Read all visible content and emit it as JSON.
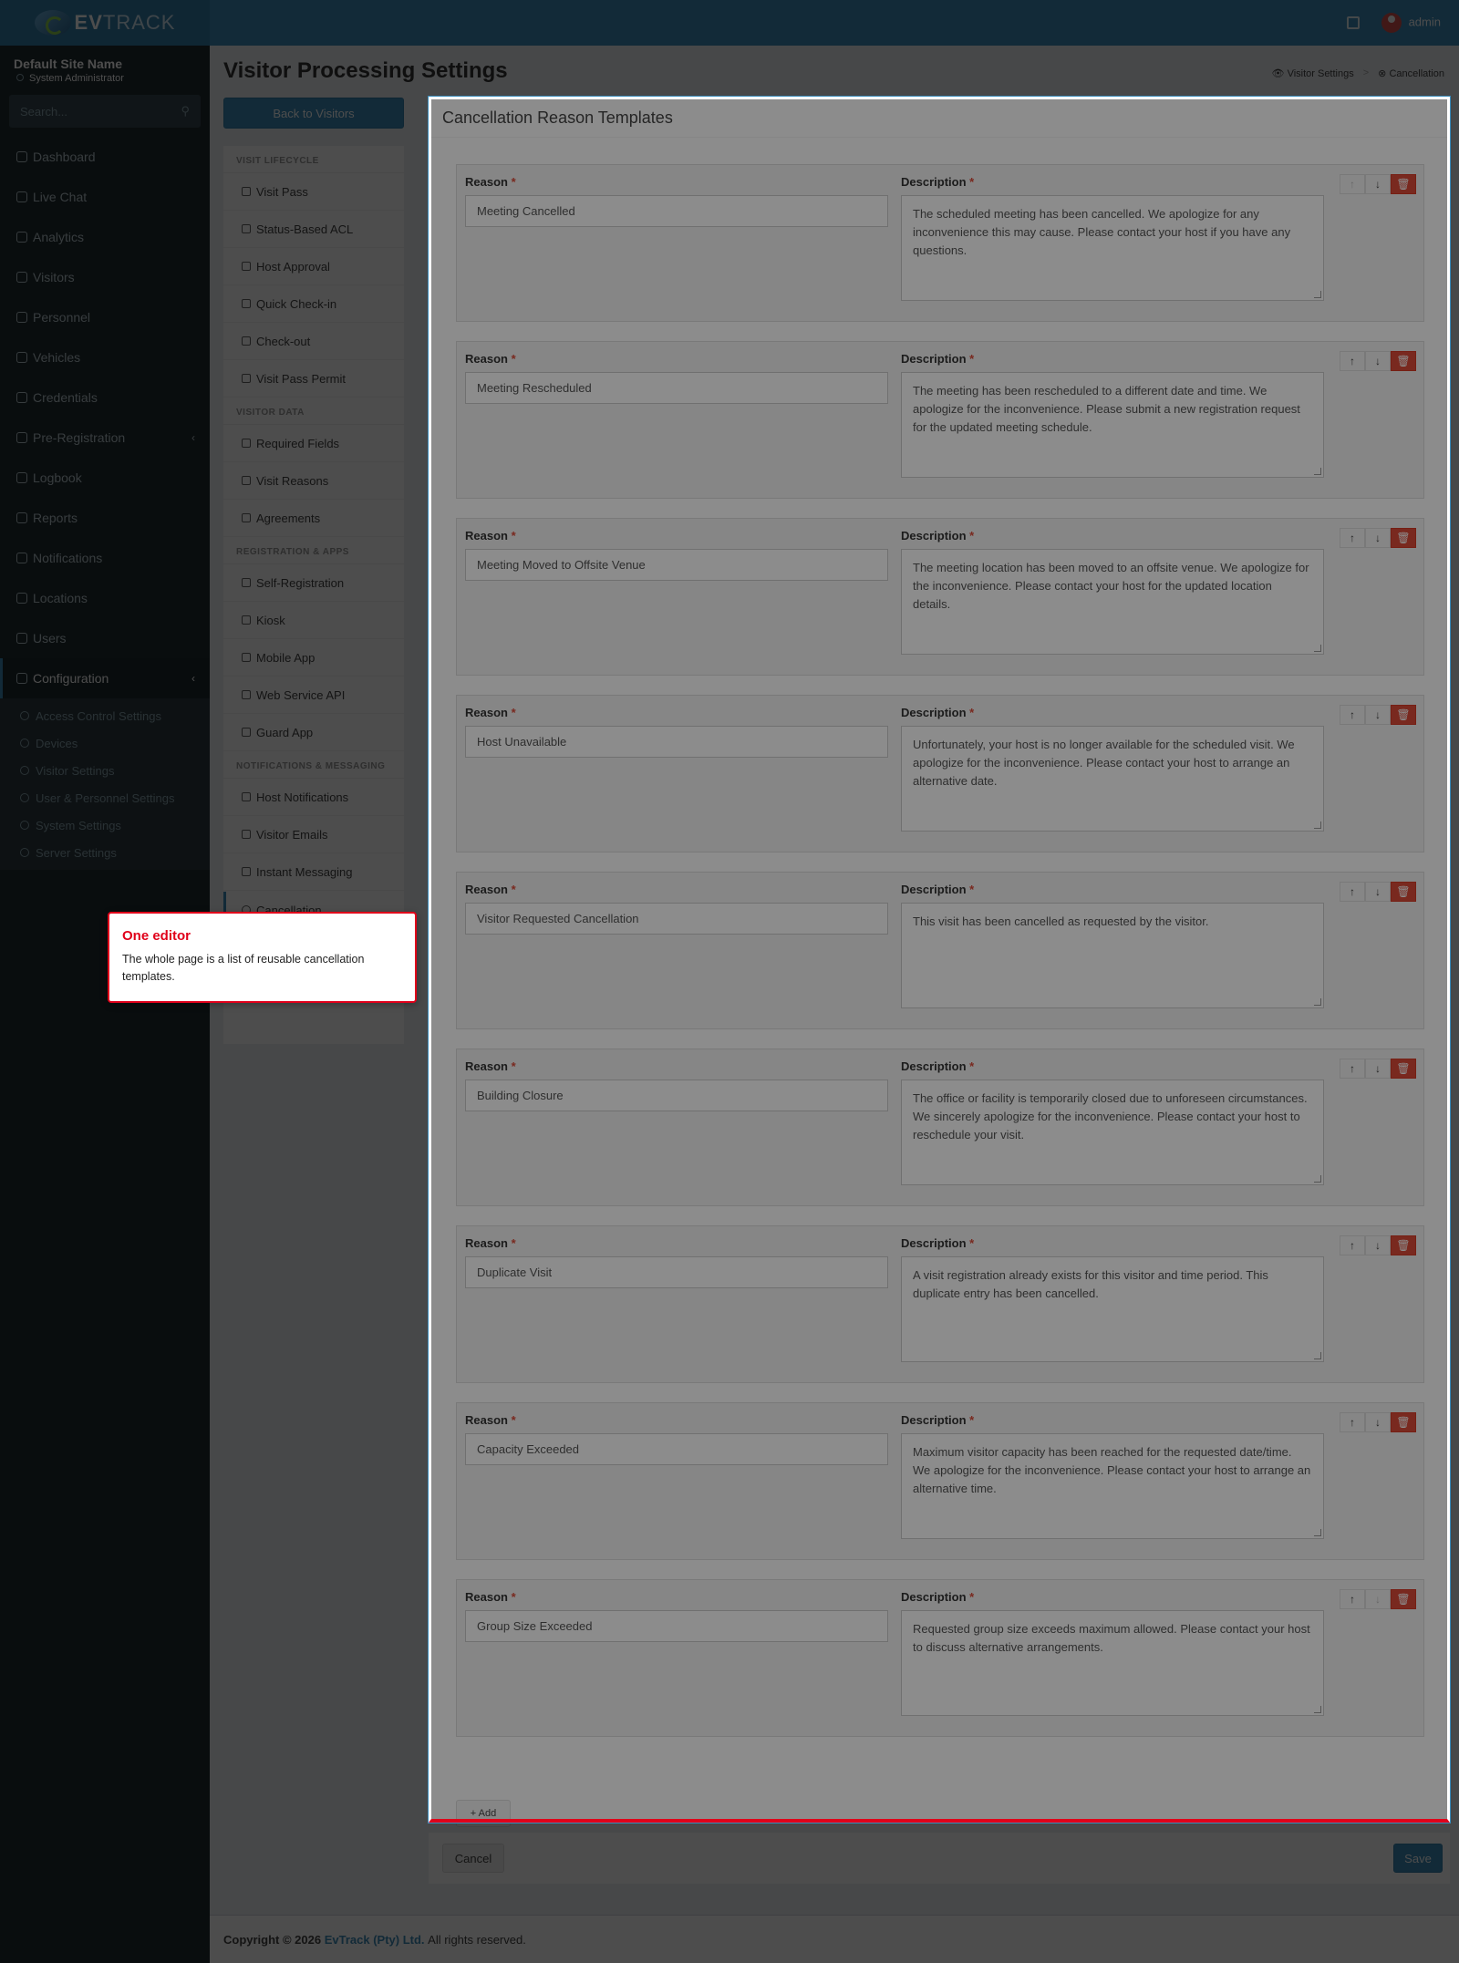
{
  "header": {
    "logo_prefix": "EV",
    "logo_suffix": "TRACK",
    "user": "admin"
  },
  "sidebar": {
    "site_name": "Default Site Name",
    "role": "System Administrator",
    "search_placeholder": "Search...",
    "items": [
      {
        "label": "Dashboard",
        "icon": "dashboard-icon"
      },
      {
        "label": "Live Chat",
        "icon": "headset-icon"
      },
      {
        "label": "Analytics",
        "icon": "analytics-icon"
      },
      {
        "label": "Visitors",
        "icon": "eye-icon"
      },
      {
        "label": "Personnel",
        "icon": "user-icon"
      },
      {
        "label": "Vehicles",
        "icon": "car-icon"
      },
      {
        "label": "Credentials",
        "icon": "id-card-icon"
      },
      {
        "label": "Pre-Registration",
        "icon": "share-icon"
      },
      {
        "label": "Logbook",
        "icon": "book-icon"
      },
      {
        "label": "Reports",
        "icon": "chart-icon"
      },
      {
        "label": "Notifications",
        "icon": "bell-icon"
      },
      {
        "label": "Locations",
        "icon": "map-icon"
      },
      {
        "label": "Users",
        "icon": "users-icon"
      },
      {
        "label": "Configuration",
        "icon": "gear-icon"
      }
    ],
    "config_sub": [
      "Access Control Settings",
      "Devices",
      "Visitor Settings",
      "User & Personnel Settings",
      "System Settings",
      "Server Settings"
    ]
  },
  "page": {
    "title": "Visitor Processing Settings",
    "crumb_1": "Visitor Settings",
    "crumb_2": "Cancellation",
    "back_label": "Back to Visitors"
  },
  "settings_nav": {
    "h1": "VISIT LIFECYCLE",
    "lifecycle": [
      "Visit Pass",
      "Status-Based ACL",
      "Host Approval",
      "Quick Check-in",
      "Check-out",
      "Visit Pass Permit"
    ],
    "h2": "VISITOR DATA",
    "visitor_data": [
      "Required Fields",
      "Visit Reasons",
      "Agreements"
    ],
    "h3": "REGISTRATION & APPS",
    "registration": [
      "Self-Registration",
      "Kiosk",
      "Mobile App",
      "Web Service API",
      "Guard App"
    ],
    "h4": "NOTIFICATIONS & MESSAGING",
    "notifications": [
      "Host Notifications",
      "Visitor Emails",
      "Instant Messaging"
    ],
    "active": "Cancellation"
  },
  "box": {
    "title": "Cancellation Reason Templates",
    "reason_label": "Reason",
    "description_label": "Description",
    "required_mark": "*",
    "add_label": "+ Add"
  },
  "templates": [
    {
      "reason": "Meeting Cancelled",
      "description": "The scheduled meeting has been cancelled. We apologize for any inconvenience this may cause. Please contact your host if you have any questions."
    },
    {
      "reason": "Meeting Rescheduled",
      "description": "The meeting has been rescheduled to a different date and time. We apologize for the inconvenience. Please submit a new registration request for the updated meeting schedule."
    },
    {
      "reason": "Meeting Moved to Offsite Venue",
      "description": "The meeting location has been moved to an offsite venue. We apologize for the inconvenience. Please contact your host for the updated location details."
    },
    {
      "reason": "Host Unavailable",
      "description": "Unfortunately, your host is no longer available for the scheduled visit. We apologize for the inconvenience. Please contact your host to arrange an alternative date."
    },
    {
      "reason": "Visitor Requested Cancellation",
      "description": "This visit has been cancelled as requested by the visitor."
    },
    {
      "reason": "Building Closure",
      "description": "The office or facility is temporarily closed due to unforeseen circumstances. We sincerely apologize for the inconvenience. Please contact your host to reschedule your visit."
    },
    {
      "reason": "Duplicate Visit",
      "description": "A visit registration already exists for this visitor and time period. This duplicate entry has been cancelled."
    },
    {
      "reason": "Capacity Exceeded",
      "description": "Maximum visitor capacity has been reached for the requested date/time. We apologize for the inconvenience. Please contact your host to arrange an alternative time."
    },
    {
      "reason": "Group Size Exceeded",
      "description": "Requested group size exceeds maximum allowed. Please contact your host to discuss alternative arrangements."
    }
  ],
  "actions": {
    "cancel_label": "Cancel",
    "save_label": "Save"
  },
  "footer": {
    "prefix": "Copyright © 2026",
    "company": "EvTrack (Pty) Ltd.",
    "suffix": "All rights reserved."
  },
  "tooltip": {
    "title": "One editor",
    "body": "The whole page is a list of reusable cancellation templates."
  },
  "colors": {
    "primary": "#3c8dbc",
    "danger": "#dd4b39",
    "sidebar": "#222d32",
    "highlight": "#e0001a"
  }
}
